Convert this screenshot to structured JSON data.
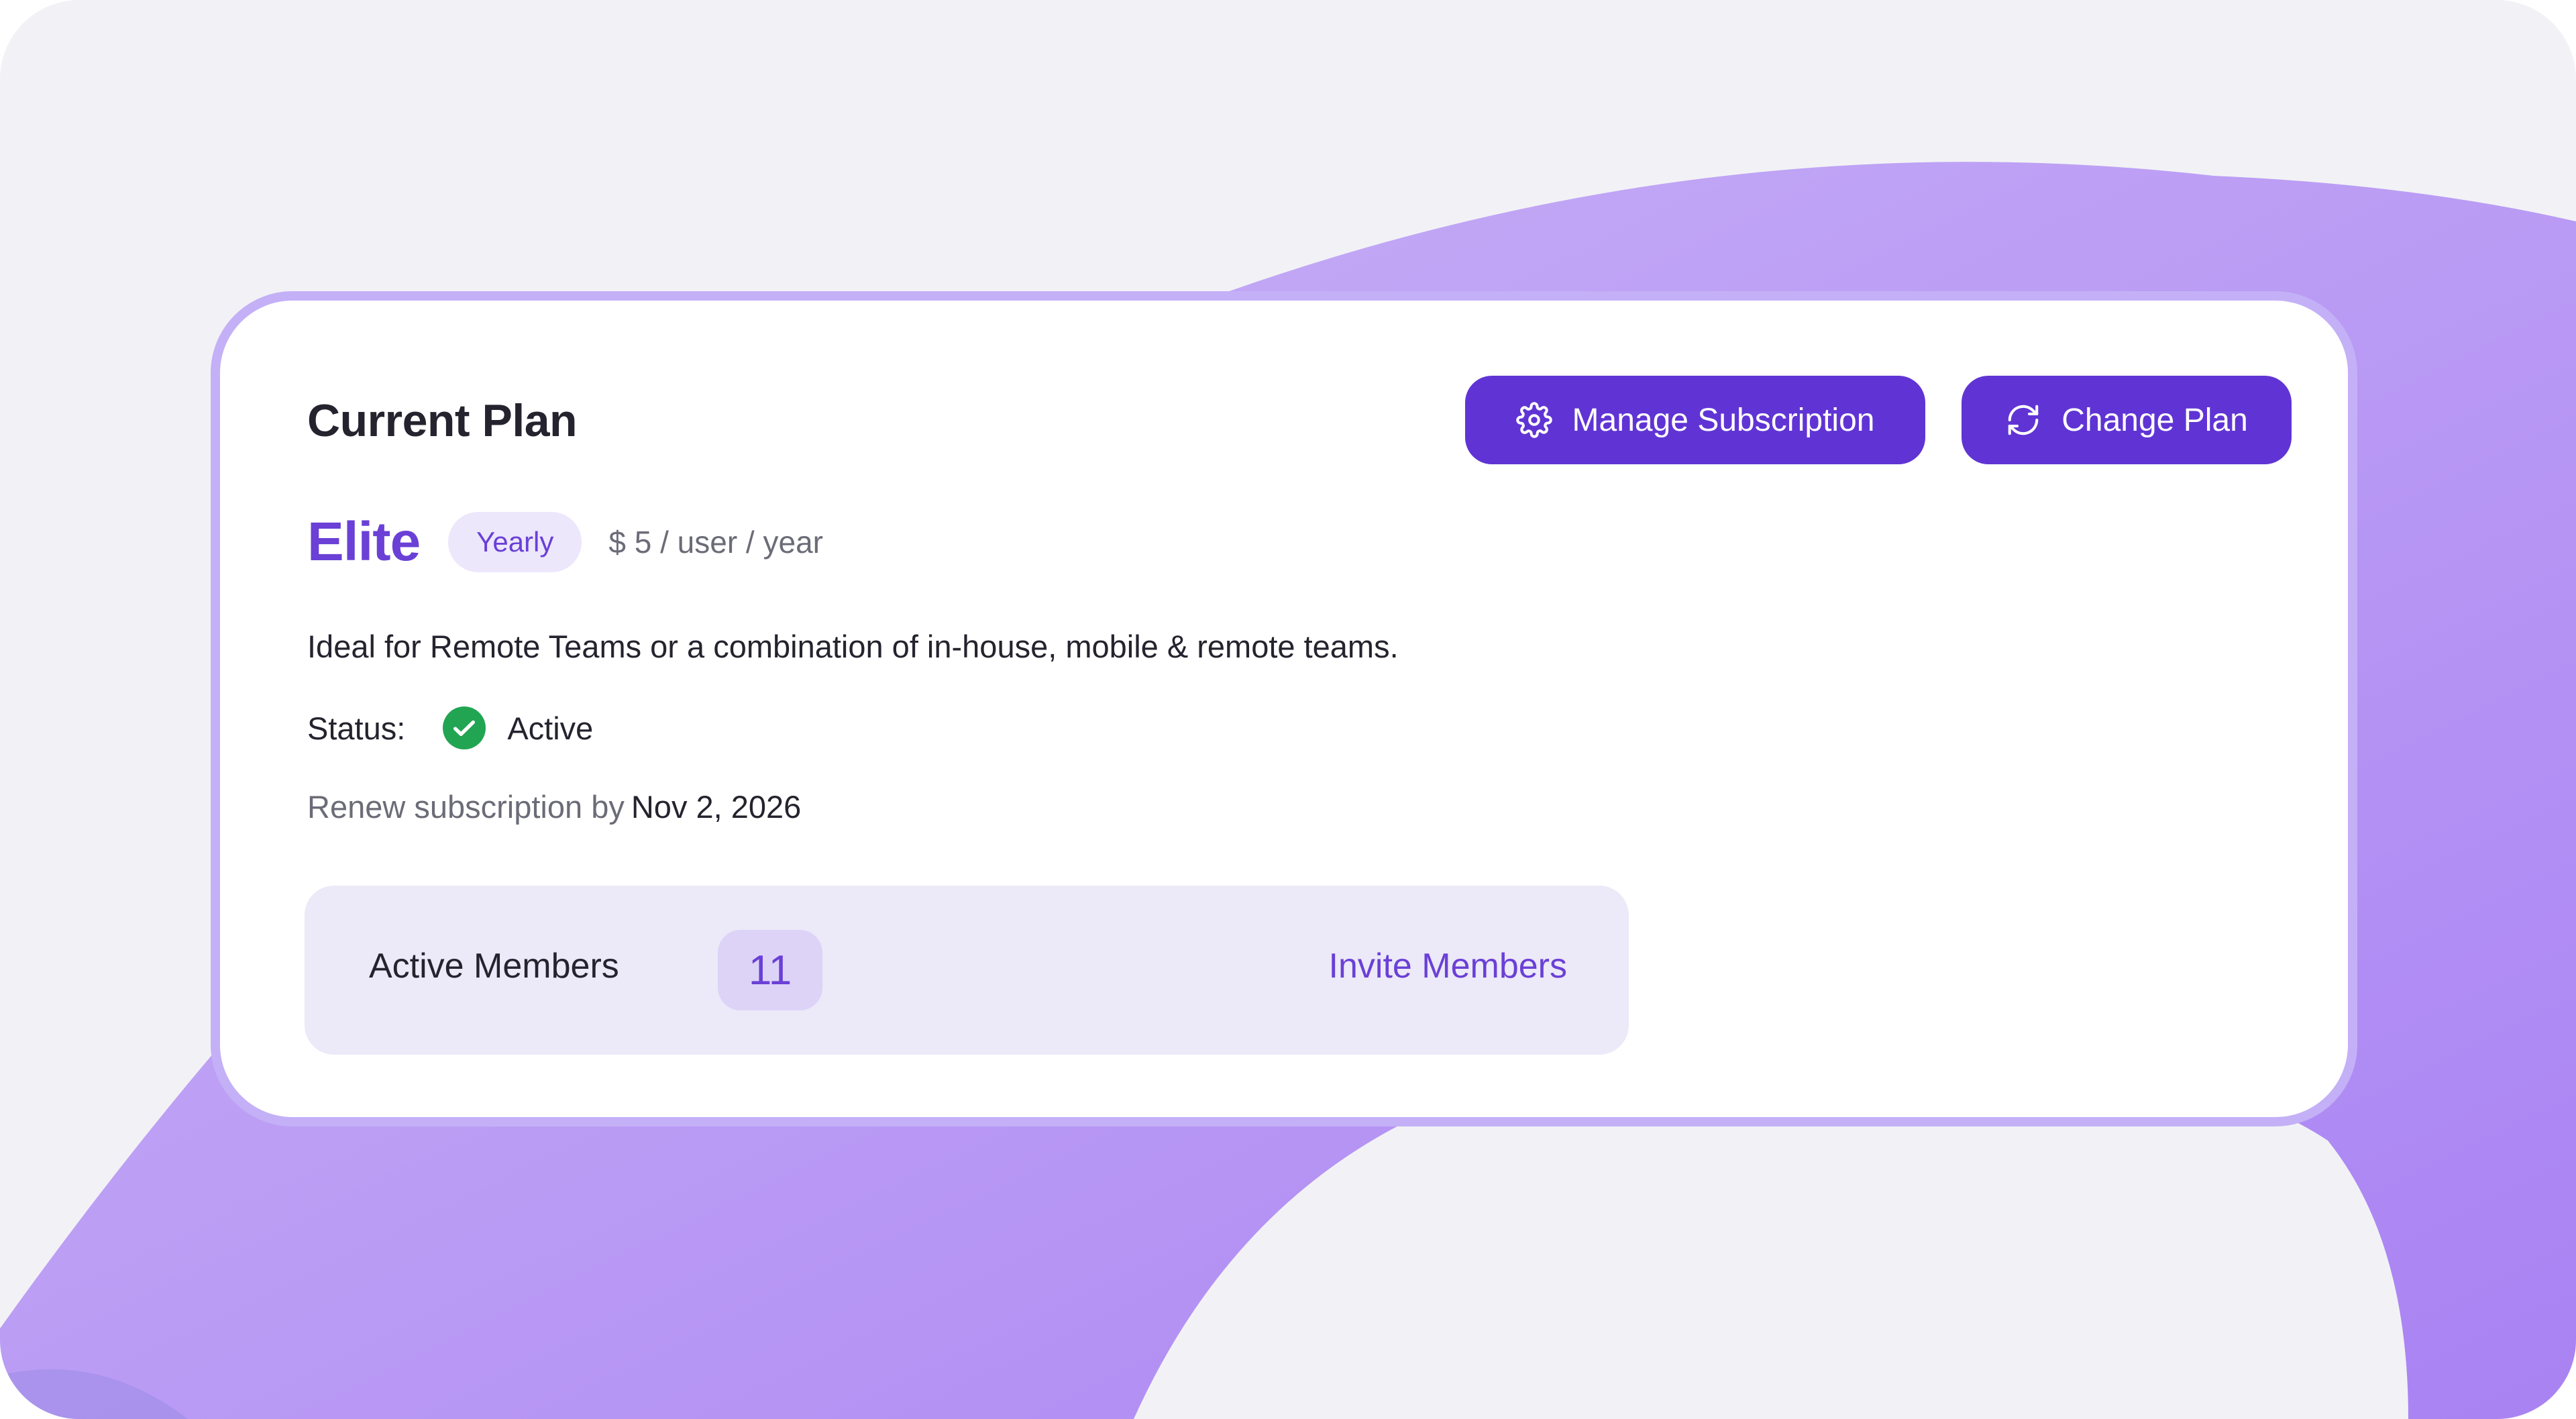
{
  "card": {
    "title": "Current Plan",
    "buttons": {
      "manage_subscription": {
        "label": "Manage Subscription",
        "icon": "gear-icon"
      },
      "change_plan": {
        "label": "Change Plan",
        "icon": "refresh-icon"
      }
    },
    "plan": {
      "name": "Elite",
      "billing_cycle": "Yearly",
      "price": "$ 5 / user / year"
    },
    "description": "Ideal for Remote Teams or a combination of in-house, mobile & remote teams.",
    "status": {
      "label": "Status:",
      "value": "Active",
      "icon": "check-circle-icon"
    },
    "renewal": {
      "text": "Renew subscription by",
      "date": "Nov 2, 2026"
    },
    "members": {
      "label": "Active Members",
      "count": "11",
      "invite_label": "Invite Members"
    }
  },
  "colors": {
    "accent": "#6034D4",
    "plan_name": "#6A40D6",
    "status_active": "#22A552",
    "card_border": "#C4B0F7",
    "background_shape": "#B18CF5"
  }
}
